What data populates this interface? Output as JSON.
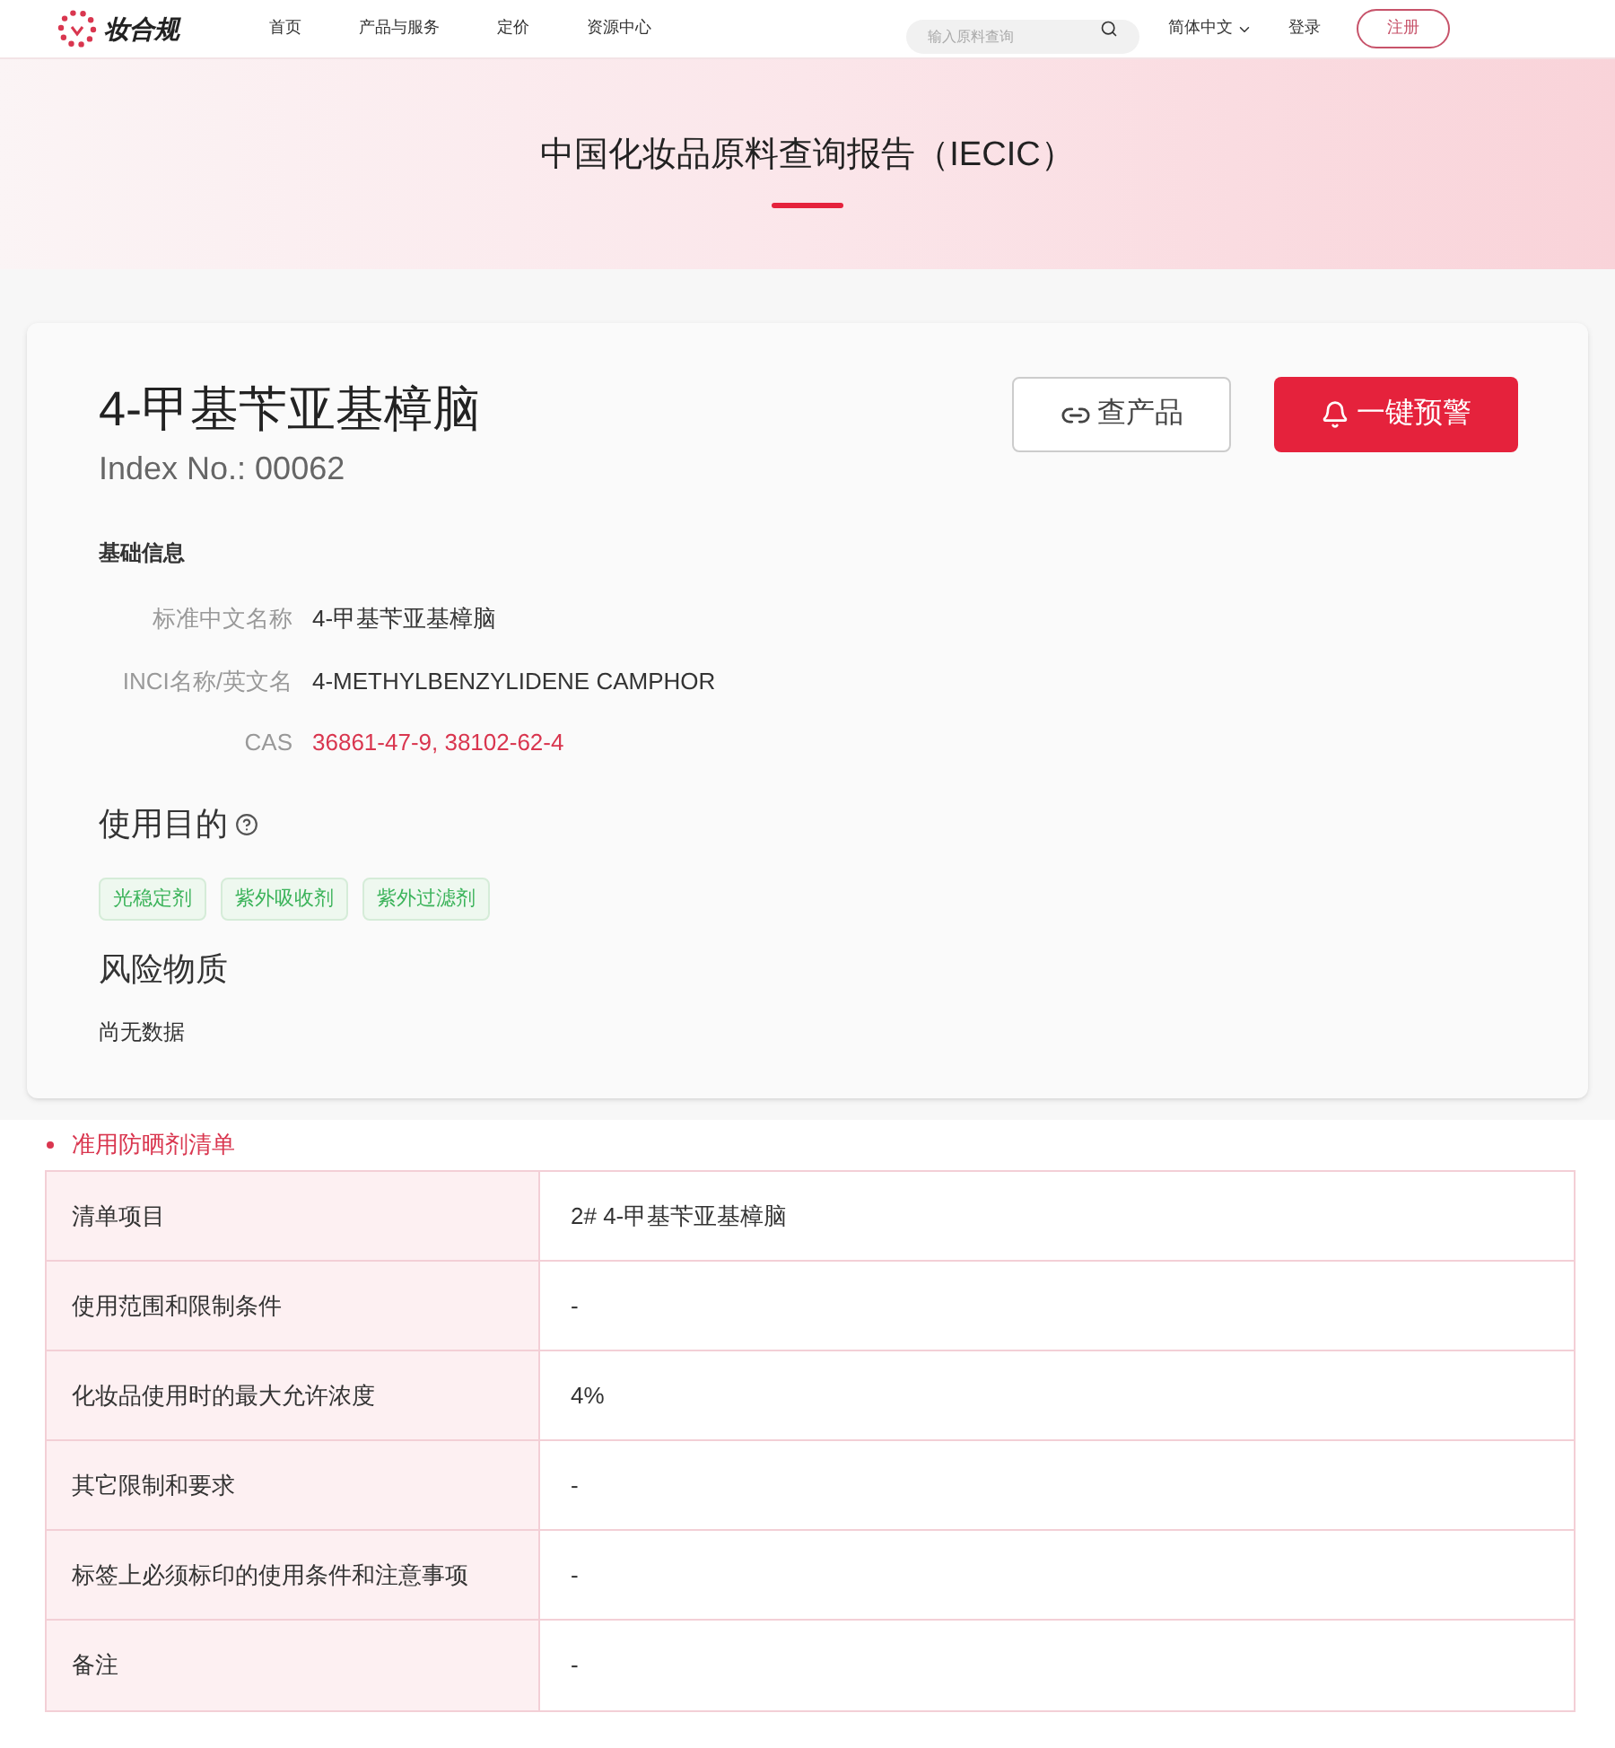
{
  "header": {
    "logo": "妆合规",
    "nav": [
      "首页",
      "产品与服务",
      "定价",
      "资源中心"
    ],
    "search": {
      "placeholder": "输入原料查询"
    },
    "language": "简体中文",
    "login": "登录",
    "register": "注册"
  },
  "banner": {
    "title": "中国化妆品原料查询报告（IECIC）"
  },
  "ingredient": {
    "name": "4-甲基苄亚基樟脑",
    "index": "Index No.: 00062",
    "buttons": [
      {
        "kind": "outline",
        "label": "查产品"
      },
      {
        "kind": "primary",
        "label": "一键预警"
      }
    ],
    "basic": {
      "heading": "基础信息",
      "fields": [
        {
          "label": "标准中文名称",
          "value": "4-甲基苄亚基樟脑",
          "kind": "plain"
        },
        {
          "label": "INCI名称/英文名",
          "value": "4-METHYLBENZYLIDENE CAMPHOR",
          "kind": "plain"
        },
        {
          "label": "CAS",
          "value": "36861-47-9, 38102-62-4",
          "kind": "link"
        }
      ]
    },
    "purpose": {
      "heading": "使用目的",
      "tags": [
        "光稳定剂",
        "紫外吸收剂",
        "紫外过滤剂"
      ]
    },
    "risk": {
      "heading": "风险物质",
      "text": "尚无数据"
    }
  },
  "list": {
    "title": "准用防晒剂清单",
    "rows": [
      {
        "label": "清单项目",
        "value": "2# 4-甲基苄亚基樟脑"
      },
      {
        "label": "使用范围和限制条件",
        "value": "-"
      },
      {
        "label": "化妆品使用时的最大允许浓度",
        "value": "4%"
      },
      {
        "label": "其它限制和要求",
        "value": "-"
      },
      {
        "label": "标签上必须标印的使用条件和注意事项",
        "value": "-"
      },
      {
        "label": "备注",
        "value": "-"
      }
    ]
  }
}
